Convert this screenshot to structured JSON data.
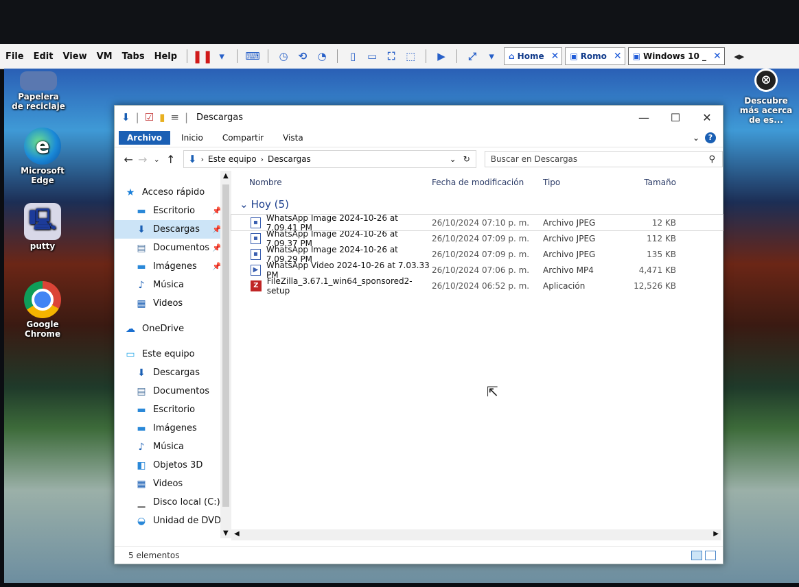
{
  "vm": {
    "menu": [
      "File",
      "Edit",
      "View",
      "VM",
      "Tabs",
      "Help"
    ],
    "tabs": [
      {
        "label": "Home"
      },
      {
        "label": "Romo"
      },
      {
        "label": "Windows 10 _"
      }
    ]
  },
  "desktop": {
    "icons": [
      {
        "label": "Papelera de reciclaje"
      },
      {
        "label": "Microsoft Edge"
      },
      {
        "label": "putty"
      },
      {
        "label": "Google Chrome"
      }
    ],
    "promo": "Descubre más acerca de es..."
  },
  "explorer": {
    "title": "Descargas",
    "ribbon_tabs": [
      "Archivo",
      "Inicio",
      "Compartir",
      "Vista"
    ],
    "address": {
      "root": "Este equipo",
      "folder": "Descargas"
    },
    "search_placeholder": "Buscar en Descargas",
    "nav": {
      "quick_access": "Acceso rápido",
      "quick_items": [
        "Escritorio",
        "Descargas",
        "Documentos",
        "Imágenes",
        "Música",
        "Videos"
      ],
      "onedrive": "OneDrive",
      "this_pc": "Este equipo",
      "pc_items": [
        "Descargas",
        "Documentos",
        "Escritorio",
        "Imágenes",
        "Música",
        "Objetos 3D",
        "Videos",
        "Disco local (C:)",
        "Unidad de DVD ("
      ]
    },
    "columns": {
      "name": "Nombre",
      "date": "Fecha de modificación",
      "type": "Tipo",
      "size": "Tamaño"
    },
    "group": "Hoy (5)",
    "files": [
      {
        "name": "WhatsApp Image 2024-10-26 at 7.09.41 PM",
        "date": "26/10/2024 07:10 p. m.",
        "type": "Archivo JPEG",
        "size": "12 KB"
      },
      {
        "name": "WhatsApp Image 2024-10-26 at 7.09.37 PM",
        "date": "26/10/2024 07:09 p. m.",
        "type": "Archivo JPEG",
        "size": "112 KB"
      },
      {
        "name": "WhatsApp Image 2024-10-26 at 7.09.29 PM",
        "date": "26/10/2024 07:09 p. m.",
        "type": "Archivo JPEG",
        "size": "135 KB"
      },
      {
        "name": "WhatsApp Video 2024-10-26 at 7.03.33 PM",
        "date": "26/10/2024 07:06 p. m.",
        "type": "Archivo MP4",
        "size": "4,471 KB"
      },
      {
        "name": "FileZilla_3.67.1_win64_sponsored2-setup",
        "date": "26/10/2024 06:52 p. m.",
        "type": "Aplicación",
        "size": "12,526 KB"
      }
    ],
    "status": "5 elementos"
  }
}
